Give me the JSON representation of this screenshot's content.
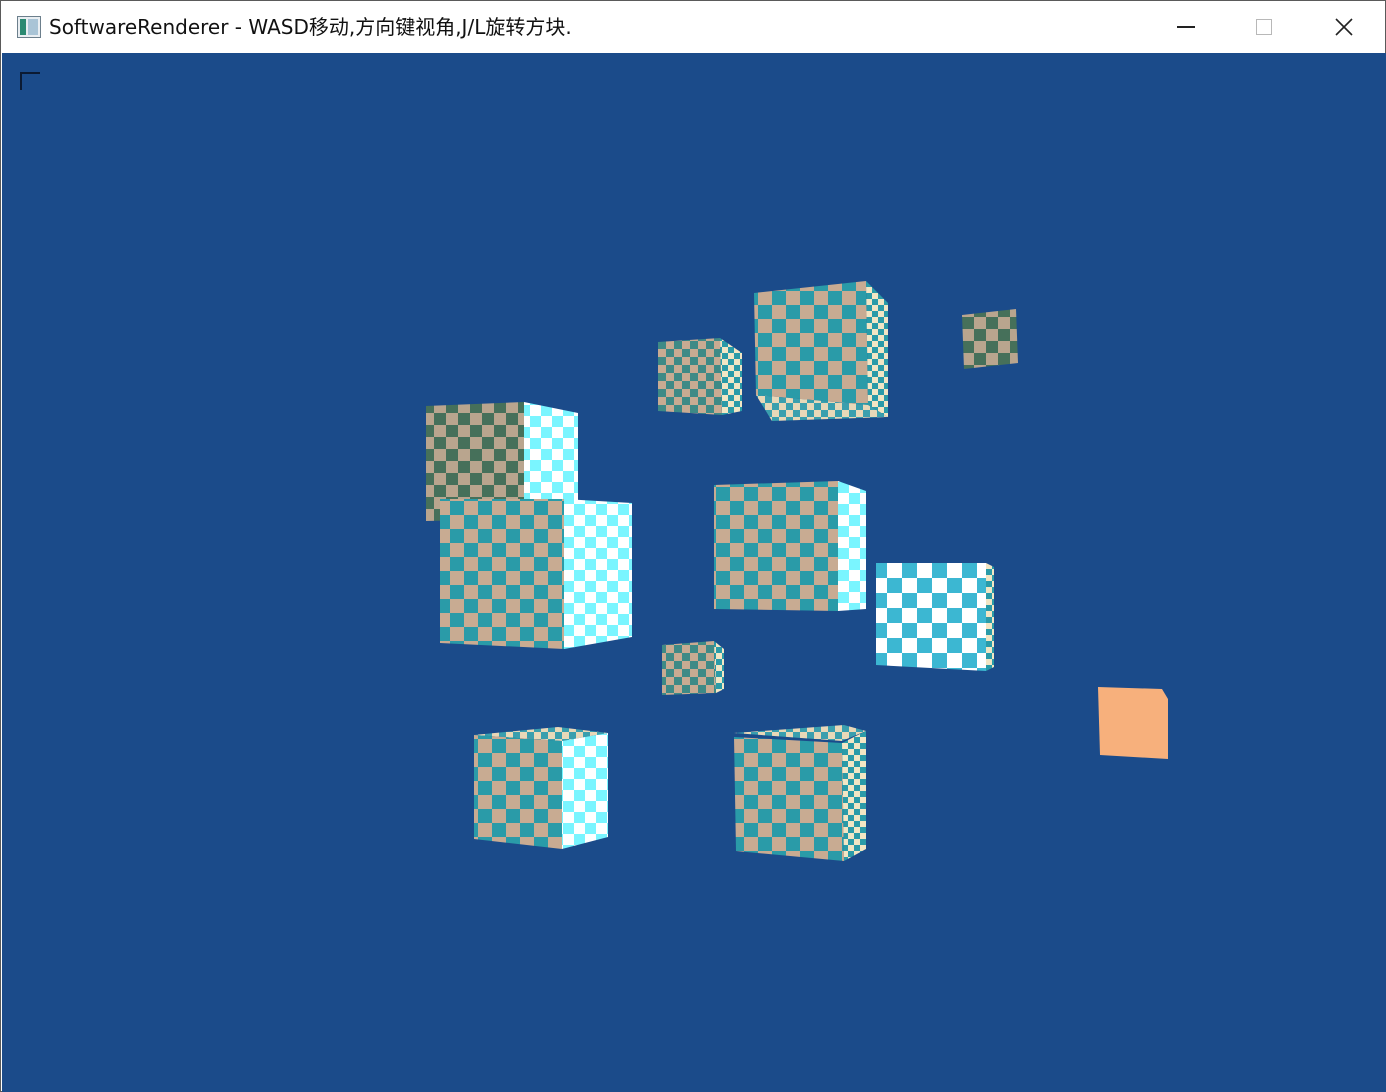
{
  "window": {
    "title": "SoftwareRenderer - WASD移动,方向键视角,J/L旋转方块.",
    "icon": "app-window-icon",
    "controls": {
      "minimize_icon": "minimize-icon",
      "maximize_icon": "maximize-icon",
      "close_icon": "close-icon"
    }
  },
  "viewport": {
    "background_color": "#1b4b8a",
    "marker_icon": "corner-bracket-icon"
  },
  "colors": {
    "teal": "#2a9ba8",
    "tan": "#c8ab92",
    "cyan_light": "#7af5ff",
    "white": "#ffffff",
    "salmon": "#f7b07c",
    "dark_olive": "#46705a"
  }
}
